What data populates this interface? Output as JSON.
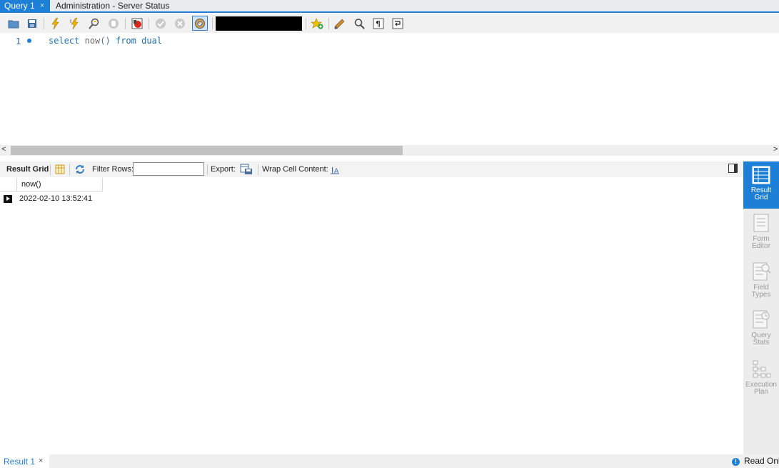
{
  "tabs": [
    {
      "label": "Query 1",
      "close": "×",
      "active": true
    },
    {
      "label": "Administration - Server Status",
      "active": false
    }
  ],
  "toolbar_icons": [
    "open-folder-icon",
    "save-icon",
    "execute-icon",
    "execute-current-icon",
    "explain-icon",
    "stop-icon",
    "toggle-error-icon",
    "commit-icon",
    "rollback-icon",
    "autocommit-icon",
    "redacted-field",
    "add-snippet-icon",
    "beautify-icon",
    "find-icon",
    "invisible-chars-icon",
    "wrap-icon"
  ],
  "editor": {
    "line_number": "1",
    "tokens": [
      {
        "text": "select",
        "kind": "kw"
      },
      {
        "text": " ",
        "kind": "plain"
      },
      {
        "text": "now",
        "kind": "plain"
      },
      {
        "text": "()",
        "kind": "fn"
      },
      {
        "text": " ",
        "kind": "plain"
      },
      {
        "text": "from",
        "kind": "kw"
      },
      {
        "text": " ",
        "kind": "plain"
      },
      {
        "text": "dual",
        "kind": "kw"
      }
    ]
  },
  "result_toolbar": {
    "result_grid": "Result Grid",
    "filter_rows": "Filter Rows:",
    "filter_value": "",
    "export": "Export:",
    "wrap_cell": "Wrap Cell Content:"
  },
  "grid": {
    "columns": [
      "now()"
    ],
    "rows": [
      [
        "2022-02-10 13:52:41"
      ]
    ]
  },
  "side_panel": [
    {
      "line1": "Result",
      "line2": "Grid",
      "active": true,
      "icon": "result-grid-icon"
    },
    {
      "line1": "Form",
      "line2": "Editor",
      "active": false,
      "icon": "form-editor-icon"
    },
    {
      "line1": "Field",
      "line2": "Types",
      "active": false,
      "icon": "field-types-icon"
    },
    {
      "line1": "Query",
      "line2": "Stats",
      "active": false,
      "icon": "query-stats-icon"
    },
    {
      "line1": "Execution",
      "line2": "Plan",
      "active": false,
      "icon": "execution-plan-icon"
    }
  ],
  "bottom": {
    "result_tab": "Result 1",
    "close": "×",
    "status": "Read Only",
    "status_icon": "!"
  },
  "colors": {
    "accent": "#1e7fd6",
    "keyword": "#1c6fb5"
  }
}
